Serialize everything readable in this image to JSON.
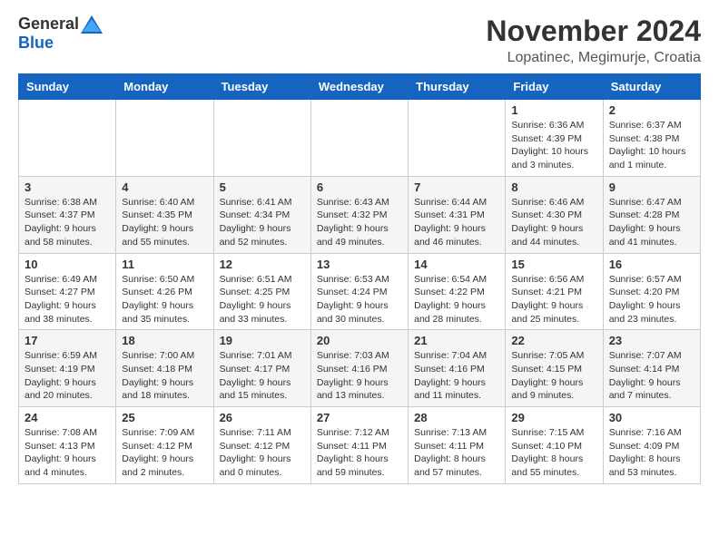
{
  "logo": {
    "general": "General",
    "blue": "Blue"
  },
  "title": "November 2024",
  "location": "Lopatinec, Megimurje, Croatia",
  "headers": [
    "Sunday",
    "Monday",
    "Tuesday",
    "Wednesday",
    "Thursday",
    "Friday",
    "Saturday"
  ],
  "rows": [
    [
      {
        "day": "",
        "info": ""
      },
      {
        "day": "",
        "info": ""
      },
      {
        "day": "",
        "info": ""
      },
      {
        "day": "",
        "info": ""
      },
      {
        "day": "",
        "info": ""
      },
      {
        "day": "1",
        "info": "Sunrise: 6:36 AM\nSunset: 4:39 PM\nDaylight: 10 hours\nand 3 minutes."
      },
      {
        "day": "2",
        "info": "Sunrise: 6:37 AM\nSunset: 4:38 PM\nDaylight: 10 hours\nand 1 minute."
      }
    ],
    [
      {
        "day": "3",
        "info": "Sunrise: 6:38 AM\nSunset: 4:37 PM\nDaylight: 9 hours\nand 58 minutes."
      },
      {
        "day": "4",
        "info": "Sunrise: 6:40 AM\nSunset: 4:35 PM\nDaylight: 9 hours\nand 55 minutes."
      },
      {
        "day": "5",
        "info": "Sunrise: 6:41 AM\nSunset: 4:34 PM\nDaylight: 9 hours\nand 52 minutes."
      },
      {
        "day": "6",
        "info": "Sunrise: 6:43 AM\nSunset: 4:32 PM\nDaylight: 9 hours\nand 49 minutes."
      },
      {
        "day": "7",
        "info": "Sunrise: 6:44 AM\nSunset: 4:31 PM\nDaylight: 9 hours\nand 46 minutes."
      },
      {
        "day": "8",
        "info": "Sunrise: 6:46 AM\nSunset: 4:30 PM\nDaylight: 9 hours\nand 44 minutes."
      },
      {
        "day": "9",
        "info": "Sunrise: 6:47 AM\nSunset: 4:28 PM\nDaylight: 9 hours\nand 41 minutes."
      }
    ],
    [
      {
        "day": "10",
        "info": "Sunrise: 6:49 AM\nSunset: 4:27 PM\nDaylight: 9 hours\nand 38 minutes."
      },
      {
        "day": "11",
        "info": "Sunrise: 6:50 AM\nSunset: 4:26 PM\nDaylight: 9 hours\nand 35 minutes."
      },
      {
        "day": "12",
        "info": "Sunrise: 6:51 AM\nSunset: 4:25 PM\nDaylight: 9 hours\nand 33 minutes."
      },
      {
        "day": "13",
        "info": "Sunrise: 6:53 AM\nSunset: 4:24 PM\nDaylight: 9 hours\nand 30 minutes."
      },
      {
        "day": "14",
        "info": "Sunrise: 6:54 AM\nSunset: 4:22 PM\nDaylight: 9 hours\nand 28 minutes."
      },
      {
        "day": "15",
        "info": "Sunrise: 6:56 AM\nSunset: 4:21 PM\nDaylight: 9 hours\nand 25 minutes."
      },
      {
        "day": "16",
        "info": "Sunrise: 6:57 AM\nSunset: 4:20 PM\nDaylight: 9 hours\nand 23 minutes."
      }
    ],
    [
      {
        "day": "17",
        "info": "Sunrise: 6:59 AM\nSunset: 4:19 PM\nDaylight: 9 hours\nand 20 minutes."
      },
      {
        "day": "18",
        "info": "Sunrise: 7:00 AM\nSunset: 4:18 PM\nDaylight: 9 hours\nand 18 minutes."
      },
      {
        "day": "19",
        "info": "Sunrise: 7:01 AM\nSunset: 4:17 PM\nDaylight: 9 hours\nand 15 minutes."
      },
      {
        "day": "20",
        "info": "Sunrise: 7:03 AM\nSunset: 4:16 PM\nDaylight: 9 hours\nand 13 minutes."
      },
      {
        "day": "21",
        "info": "Sunrise: 7:04 AM\nSunset: 4:16 PM\nDaylight: 9 hours\nand 11 minutes."
      },
      {
        "day": "22",
        "info": "Sunrise: 7:05 AM\nSunset: 4:15 PM\nDaylight: 9 hours\nand 9 minutes."
      },
      {
        "day": "23",
        "info": "Sunrise: 7:07 AM\nSunset: 4:14 PM\nDaylight: 9 hours\nand 7 minutes."
      }
    ],
    [
      {
        "day": "24",
        "info": "Sunrise: 7:08 AM\nSunset: 4:13 PM\nDaylight: 9 hours\nand 4 minutes."
      },
      {
        "day": "25",
        "info": "Sunrise: 7:09 AM\nSunset: 4:12 PM\nDaylight: 9 hours\nand 2 minutes."
      },
      {
        "day": "26",
        "info": "Sunrise: 7:11 AM\nSunset: 4:12 PM\nDaylight: 9 hours\nand 0 minutes."
      },
      {
        "day": "27",
        "info": "Sunrise: 7:12 AM\nSunset: 4:11 PM\nDaylight: 8 hours\nand 59 minutes."
      },
      {
        "day": "28",
        "info": "Sunrise: 7:13 AM\nSunset: 4:11 PM\nDaylight: 8 hours\nand 57 minutes."
      },
      {
        "day": "29",
        "info": "Sunrise: 7:15 AM\nSunset: 4:10 PM\nDaylight: 8 hours\nand 55 minutes."
      },
      {
        "day": "30",
        "info": "Sunrise: 7:16 AM\nSunset: 4:09 PM\nDaylight: 8 hours\nand 53 minutes."
      }
    ]
  ]
}
